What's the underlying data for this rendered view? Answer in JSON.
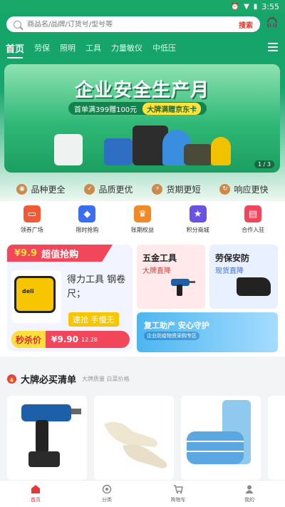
{
  "status": {
    "time": "3:55"
  },
  "search": {
    "placeholder": "商品名/品牌/订货号/型号等",
    "button": "搜索"
  },
  "tabs": [
    "首页",
    "劳保",
    "照明",
    "工具",
    "力量敏仪",
    "中低压"
  ],
  "banner": {
    "title": "企业安全生产月",
    "pill_left": "首单满399赠100元",
    "pill_right": "大牌满赠京东卡",
    "indicator": "1 / 3"
  },
  "features": [
    "品种更全",
    "品质更优",
    "货期更短",
    "响应更快"
  ],
  "icon_nav": [
    {
      "label": "领券广场",
      "icon": "coupon-icon",
      "color": "#f05a34"
    },
    {
      "label": "限时抢购",
      "icon": "tag-icon",
      "color": "#3b6df0"
    },
    {
      "label": "账期权益",
      "icon": "trophy-icon",
      "color": "#f08a28"
    },
    {
      "label": "积分商城",
      "icon": "store-icon",
      "color": "#6a52e0"
    },
    {
      "label": "合作入驻",
      "icon": "building-icon",
      "color": "#f0455a"
    }
  ],
  "flash": {
    "price_tag": "¥9.9",
    "title": "超值抢购",
    "name": "得力工具 钢卷尺；",
    "hot": "速抢 手慢无",
    "kill": "秒杀价",
    "price": "¥9.90",
    "date": "12.28"
  },
  "cards": {
    "hardware": {
      "title": "五金工具",
      "sub": "大牌直降"
    },
    "safety": {
      "title": "劳保安防",
      "sub": "现货直降"
    },
    "resume": {
      "title": "复工助产 安心守护",
      "sub": "企业防疫物资采购专区"
    }
  },
  "brand": {
    "title": "大牌必买清单",
    "sub": "大牌质量 白菜价格"
  },
  "products": [
    "电钻",
    "手套",
    "口罩"
  ],
  "bottom_nav": [
    {
      "label": "首页",
      "icon": "home-icon"
    },
    {
      "label": "分类",
      "icon": "category-icon"
    },
    {
      "label": "购物车",
      "icon": "cart-icon"
    },
    {
      "label": "我的",
      "icon": "user-icon"
    }
  ],
  "colors": {
    "brand_green": "#15a46a",
    "accent_red": "#e8372c"
  }
}
